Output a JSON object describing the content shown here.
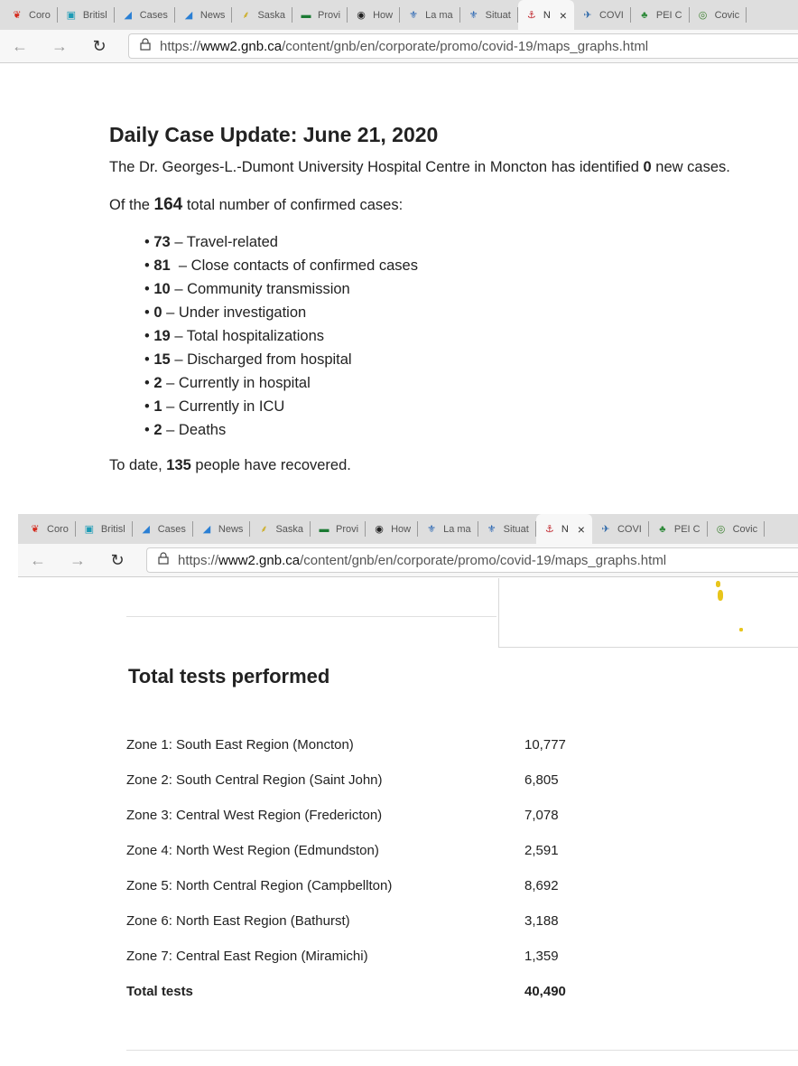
{
  "browser_top": {
    "tabs": [
      {
        "label": "Coro",
        "icon": "maple-leaf-icon"
      },
      {
        "label": "Britisl",
        "icon": "bc-icon"
      },
      {
        "label": "Cases",
        "icon": "chart-icon"
      },
      {
        "label": "News",
        "icon": "chart-icon"
      },
      {
        "label": "Saska",
        "icon": "wheat-icon"
      },
      {
        "label": "Provi",
        "icon": "flag-icon"
      },
      {
        "label": "How",
        "icon": "shield-icon"
      },
      {
        "label": "La ma",
        "icon": "fleur-de-lis-icon"
      },
      {
        "label": "Situat",
        "icon": "fleur-de-lis-icon"
      },
      {
        "label": "N",
        "icon": "nb-ship-icon",
        "active": true
      },
      {
        "label": "COVI",
        "icon": "ns-icon"
      },
      {
        "label": "PEI C",
        "icon": "tree-icon"
      },
      {
        "label": "Covic",
        "icon": "globe-icon"
      }
    ],
    "url_prefix": "https://",
    "url_host": "www2.gnb.ca",
    "url_path": "/content/gnb/en/corporate/promo/covid-19/maps_graphs.html"
  },
  "browser_bottom": {
    "tabs": [
      {
        "label": "Coro",
        "icon": "maple-leaf-icon"
      },
      {
        "label": "Britisl",
        "icon": "bc-icon"
      },
      {
        "label": "Cases",
        "icon": "chart-icon"
      },
      {
        "label": "News",
        "icon": "chart-icon"
      },
      {
        "label": "Saska",
        "icon": "wheat-icon"
      },
      {
        "label": "Provi",
        "icon": "flag-icon"
      },
      {
        "label": "How",
        "icon": "shield-icon"
      },
      {
        "label": "La ma",
        "icon": "fleur-de-lis-icon"
      },
      {
        "label": "Situat",
        "icon": "fleur-de-lis-icon"
      },
      {
        "label": "N",
        "icon": "nb-ship-icon",
        "active": true
      },
      {
        "label": "COVI",
        "icon": "ns-icon"
      },
      {
        "label": "PEI C",
        "icon": "tree-icon"
      },
      {
        "label": "Covic",
        "icon": "globe-icon"
      }
    ],
    "url_prefix": "https://",
    "url_host": "www2.gnb.ca",
    "url_path": "/content/gnb/en/corporate/promo/covid-19/maps_graphs.html"
  },
  "update": {
    "title": "Daily Case Update: June 21, 2020",
    "intro_before": "The Dr. Georges-L.-Dumont University Hospital Centre in Moncton has identified ",
    "intro_number": "0",
    "intro_after": " new cases.",
    "count_before": "Of the ",
    "count_number": "164",
    "count_after": " total number of confirmed cases:",
    "stats": [
      {
        "n": "73",
        "sep": " – ",
        "label": "Travel-related"
      },
      {
        "n": "81",
        "sep": "  – ",
        "label": "Close contacts of confirmed cases"
      },
      {
        "n": "10",
        "sep": " – ",
        "label": "Community transmission"
      },
      {
        "n": "0",
        "sep": " – ",
        "label": "Under investigation"
      },
      {
        "n": "19",
        "sep": " – ",
        "label": "Total hospitalizations"
      },
      {
        "n": "15",
        "sep": " – ",
        "label": "Discharged from hospital"
      },
      {
        "n": "2",
        "sep": " – ",
        "label": "Currently in hospital"
      },
      {
        "n": "1",
        "sep": " – ",
        "label": "Currently in ICU"
      },
      {
        "n": "2",
        "sep": " – ",
        "label": "Deaths"
      }
    ],
    "recovered_before": "To date, ",
    "recovered_number": "135",
    "recovered_after": " people have recovered."
  },
  "tests": {
    "title": "Total tests performed",
    "rows": [
      {
        "zone": "Zone 1: South East Region (Moncton)",
        "value": "10,777"
      },
      {
        "zone": "Zone 2: South Central Region (Saint John)",
        "value": "6,805"
      },
      {
        "zone": "Zone 3: Central West Region (Fredericton)",
        "value": "7,078"
      },
      {
        "zone": "Zone 4: North West Region (Edmundston)",
        "value": "2,591"
      },
      {
        "zone": "Zone 5: North Central Region (Campbellton)",
        "value": "8,692"
      },
      {
        "zone": "Zone 6: North East Region (Bathurst)",
        "value": "3,188"
      },
      {
        "zone": "Zone 7: Central East Region (Miramichi)",
        "value": "1,359"
      }
    ],
    "total_label": "Total tests",
    "total_value": "40,490"
  },
  "colors": {
    "accent_blue": "#2a7fd4",
    "map_yellow": "#e8c51b",
    "text": "#222222"
  }
}
